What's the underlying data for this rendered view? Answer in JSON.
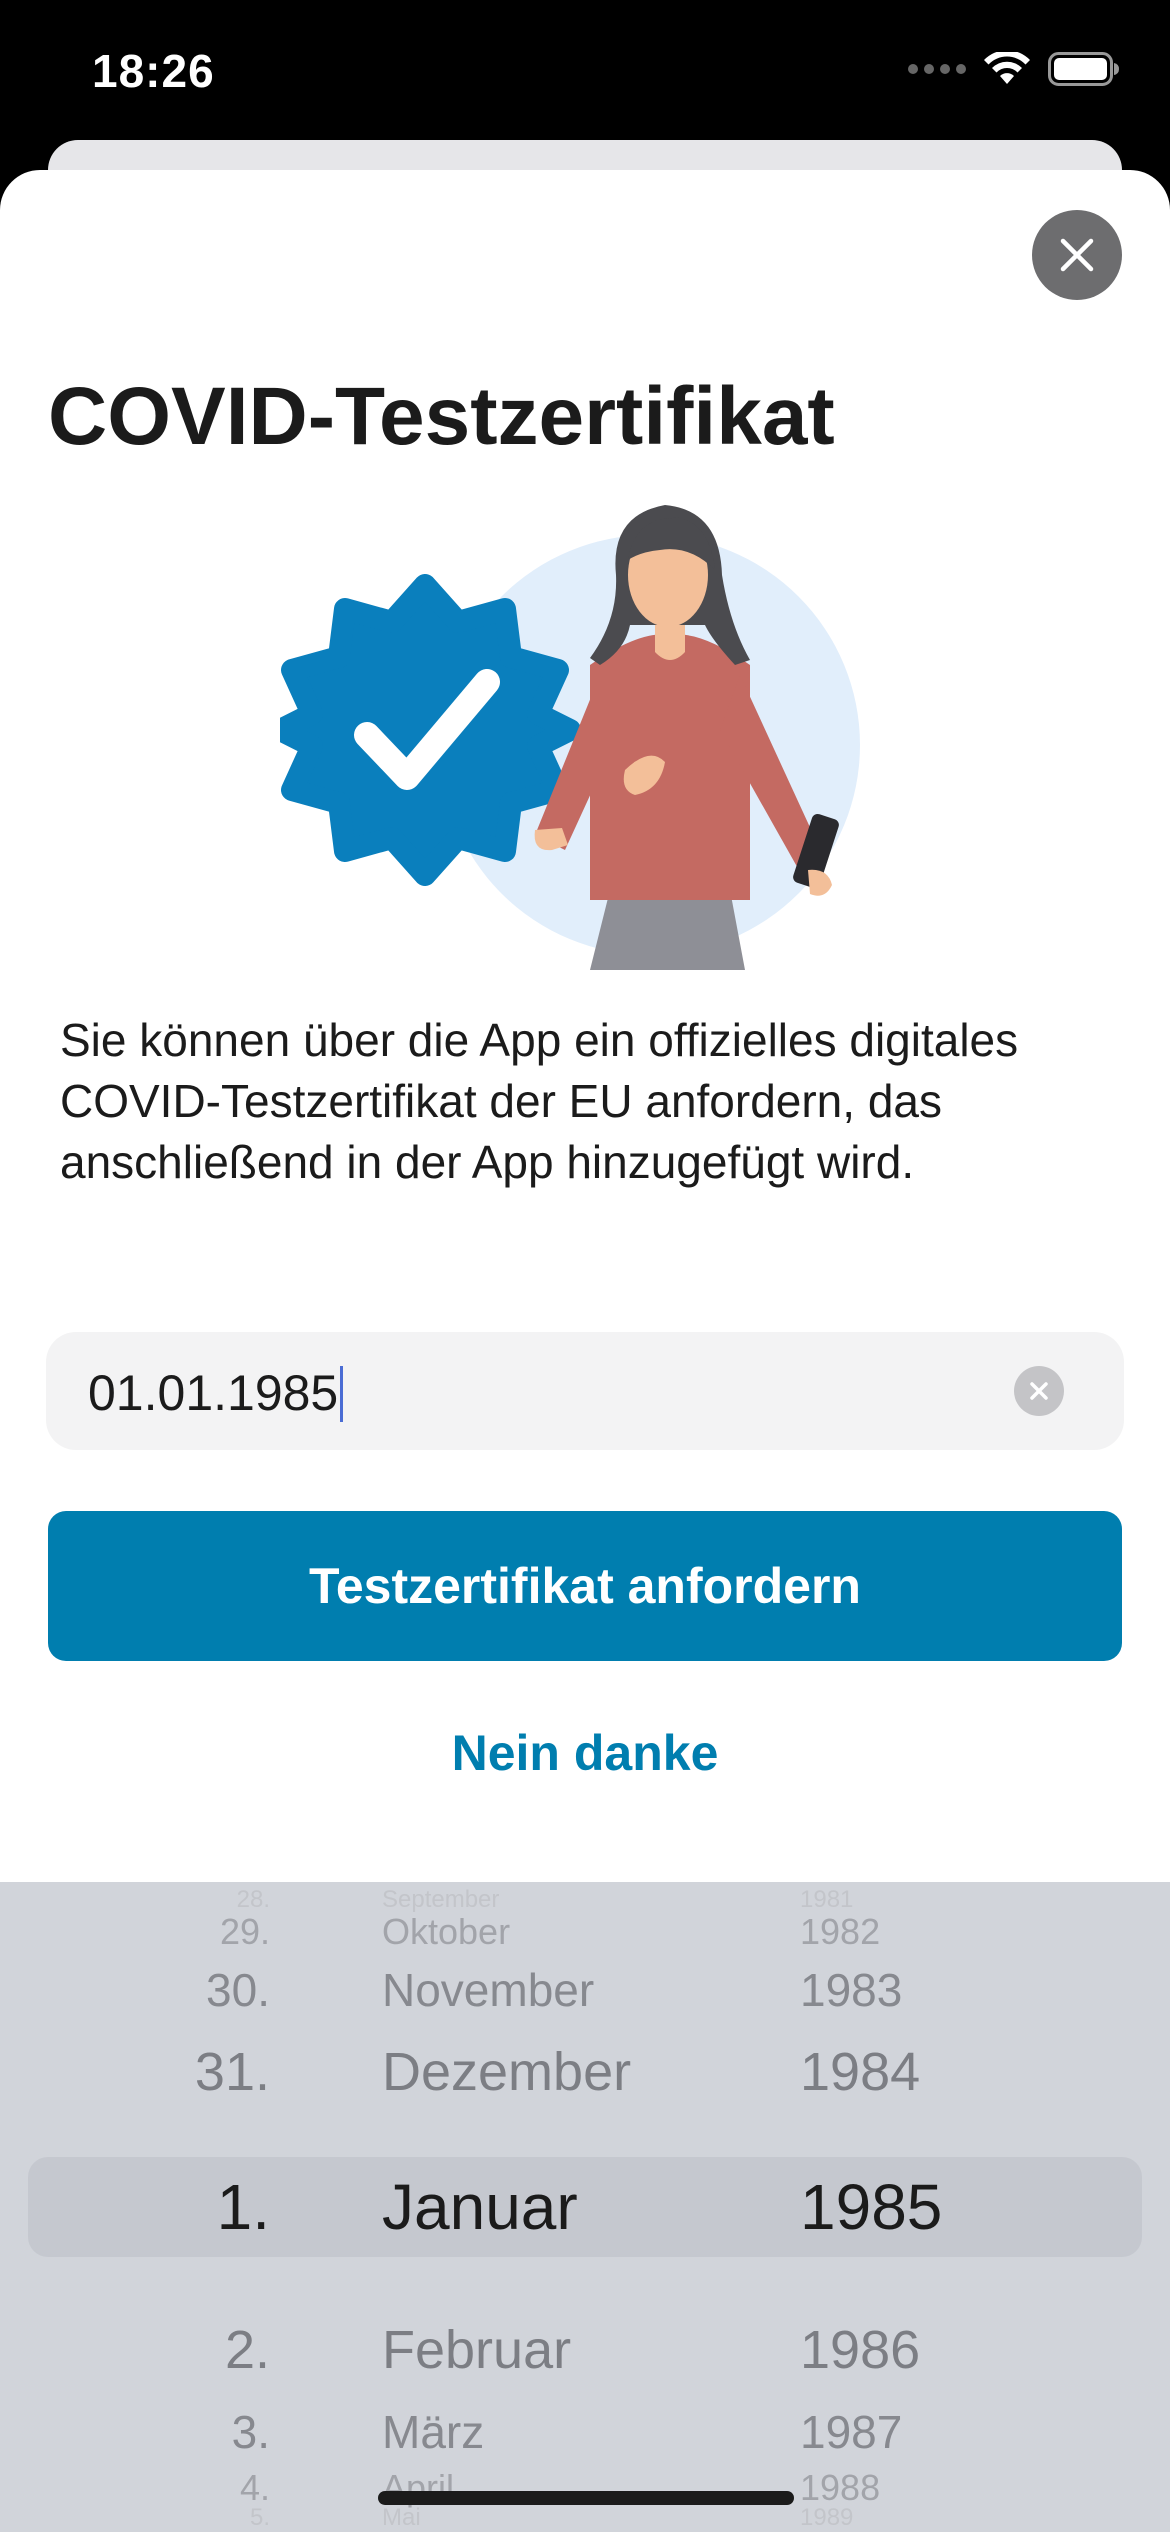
{
  "status_bar": {
    "time": "18:26"
  },
  "sheet": {
    "title": "COVID-Testzertifikat",
    "description": "Sie können über die App ein offizielles digitales COVID-Testzertifikat der EU anfordern, das anschließend in der App hinzugefügt wird.",
    "date_input": {
      "value": "01.01.1985"
    },
    "primary_button": "Testzertifikat anfordern",
    "secondary_button": "Nein danke"
  },
  "picker": {
    "rows": [
      {
        "day": "28.",
        "month": "September",
        "year": "1981"
      },
      {
        "day": "29.",
        "month": "Oktober",
        "year": "1982"
      },
      {
        "day": "30.",
        "month": "November",
        "year": "1983"
      },
      {
        "day": "31.",
        "month": "Dezember",
        "year": "1984"
      },
      {
        "day": "1.",
        "month": "Januar",
        "year": "1985"
      },
      {
        "day": "2.",
        "month": "Februar",
        "year": "1986"
      },
      {
        "day": "3.",
        "month": "März",
        "year": "1987"
      },
      {
        "day": "4.",
        "month": "April",
        "year": "1988"
      },
      {
        "day": "5.",
        "month": "Mai",
        "year": "1989"
      }
    ]
  },
  "colors": {
    "accent": "#007eaf",
    "badge": "#0a7fbd",
    "sheet_bg": "#ffffff",
    "picker_bg": "#d1d4da"
  },
  "icons": {
    "close": "close-icon",
    "clear": "clear-icon",
    "badge": "verified-badge-icon"
  }
}
